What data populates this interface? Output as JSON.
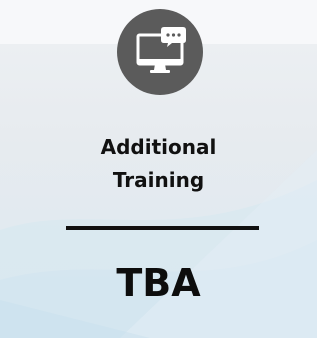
{
  "card": {
    "title_line1": "Additional",
    "title_line2": "Training",
    "status": "TBA"
  },
  "icon": {
    "name": "computer-chat-icon",
    "circle_color": "#5b5b5b",
    "glyph_color": "#ffffff"
  },
  "colors": {
    "text": "#111111",
    "background": "#e7ebef",
    "accent_wave": "#cfe3ef"
  }
}
